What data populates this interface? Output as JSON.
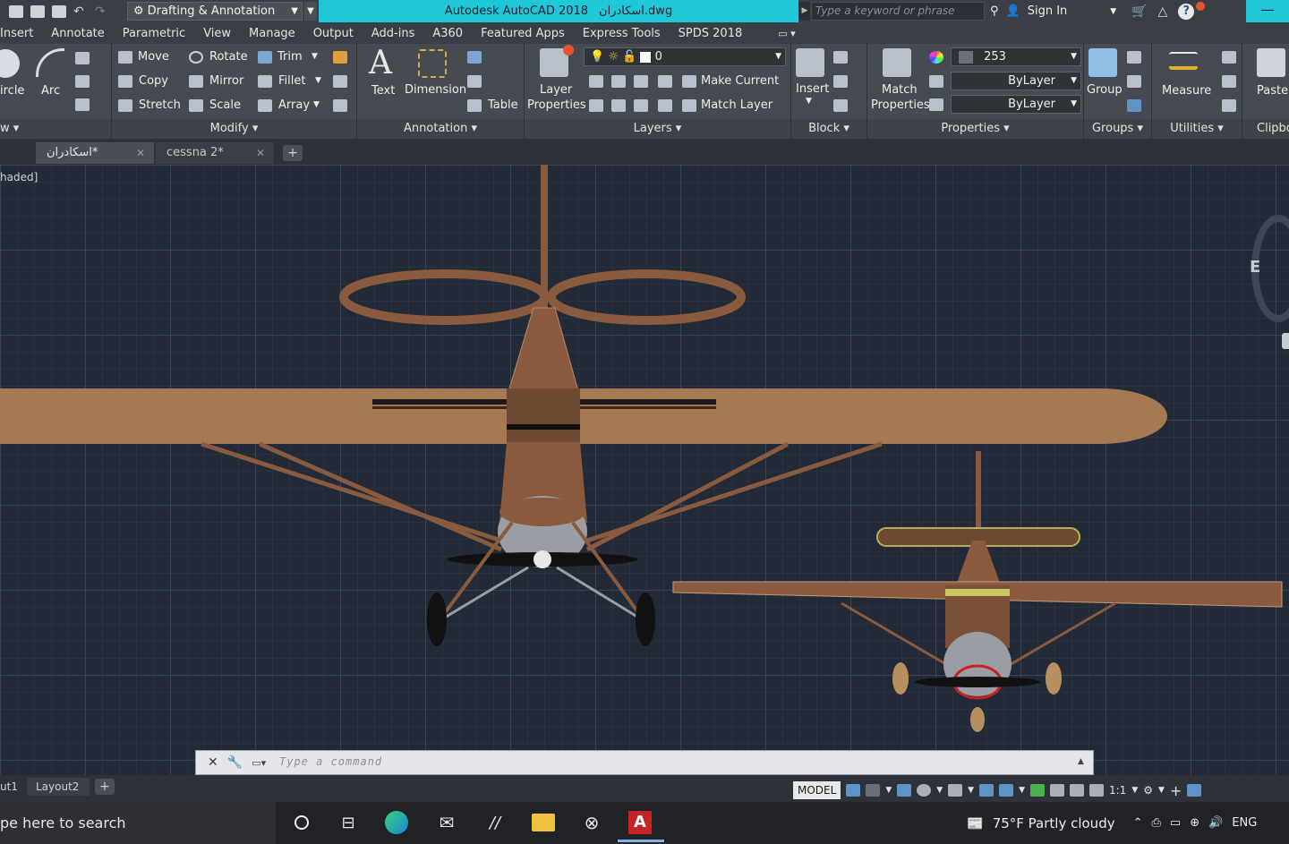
{
  "titlebar": {
    "workspace": "Drafting & Annotation",
    "app_title": "Autodesk AutoCAD 2018",
    "file_name": "اسکادران.dwg",
    "search_placeholder": "Type a keyword or phrase",
    "sign_in": "Sign In"
  },
  "menu_tabs": [
    "Insert",
    "Annotate",
    "Parametric",
    "View",
    "Manage",
    "Output",
    "Add-ins",
    "A360",
    "Featured Apps",
    "Express Tools",
    "SPDS 2018"
  ],
  "ribbon": {
    "draw": {
      "circle": "ircle",
      "arc": "Arc",
      "panel": "w"
    },
    "modify": {
      "move": "Move",
      "rotate": "Rotate",
      "trim": "Trim",
      "copy": "Copy",
      "mirror": "Mirror",
      "fillet": "Fillet",
      "stretch": "Stretch",
      "scale": "Scale",
      "array": "Array",
      "panel": "Modify"
    },
    "annotation": {
      "text": "Text",
      "dimension": "Dimension",
      "table": "Table",
      "panel": "Annotation"
    },
    "layers": {
      "layer_properties_1": "Layer",
      "layer_properties_2": "Properties",
      "current_layer": "0",
      "make_current": "Make Current",
      "match_layer": "Match Layer",
      "panel": "Layers"
    },
    "block": {
      "insert": "Insert",
      "panel": "Block"
    },
    "properties": {
      "match_1": "Match",
      "match_2": "Properties",
      "color": "253",
      "linetype": "ByLayer",
      "lineweight": "ByLayer",
      "panel": "Properties"
    },
    "groups": {
      "group": "Group",
      "panel": "Groups"
    },
    "utilities": {
      "measure": "Measure",
      "panel": "Utilities"
    },
    "clipboard": {
      "paste": "Paste",
      "panel": "Clipbo"
    }
  },
  "doc_tabs": [
    {
      "label": "اسکادران*"
    },
    {
      "label": "cessna 2*"
    }
  ],
  "viewport": {
    "label": "haded]",
    "viewcube_face": "E"
  },
  "command": {
    "placeholder": "Type  a  command"
  },
  "layout_tabs": [
    "ut1",
    "Layout2"
  ],
  "status": {
    "model": "MODEL",
    "scale": "1:1"
  },
  "taskbar": {
    "search": "pe here to search",
    "weather": "75°F  Partly cloudy",
    "lang": "ENG"
  },
  "colors": {
    "accent_cyan": "#1fc8d8",
    "airframe": "#8a5a3e",
    "wing_fabric": "#a57a52",
    "viewport_bg": "#222a38"
  }
}
